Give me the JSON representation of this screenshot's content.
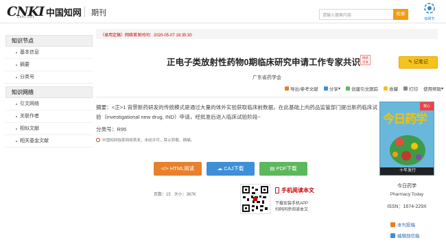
{
  "header": {
    "logo_mark": "CNKI",
    "logo_cn": "中国知网",
    "logo_sub": "cnki.net",
    "section": "期刊",
    "search_placeholder": "请输入搜索内容",
    "search_button": "检索",
    "brand_sub": "知网节"
  },
  "sidebar": {
    "groups": [
      {
        "title": "知识节点",
        "items": [
          "基本信息",
          "摘要",
          "分类号"
        ]
      },
      {
        "title": "知识网络",
        "items": [
          "引文网络",
          "关联作者",
          "相似文献",
          "相关基金文献"
        ]
      }
    ]
  },
  "article": {
    "pub_notice": "（录用定稿）网络首发时间：2020-05-07 16:35:30",
    "title": "正电子类放射性药物0期临床研究申请工作专家共识",
    "tag": "网络首发",
    "note_button": "记笔记",
    "author": "广东省药学会",
    "toolbar": [
      "导出/参考文献",
      "分享",
      "创建引文跟踪",
      "收藏",
      "打印",
      "使用帮助"
    ],
    "abstract_label": "摘要：",
    "abstract": "<正>1 背景新药研发的传统模式是通过大量的体外实验获取临床前数据，在此基础上向药品监管部门提出新药临床试验（investigational new drug, IND）申请，经批准后进入临床试验阶段~",
    "class_label": "分类号：",
    "class_value": "R95",
    "copyright": "中国知网独家网络首发，未经许可，禁止转载、摘编。"
  },
  "downloads": {
    "html": "HTML阅读",
    "caj": "CAJ下载",
    "pdf": "PDF下载"
  },
  "meta": {
    "pages_label": "页数：",
    "pages": "15",
    "size_label": "大小：",
    "size": "367K"
  },
  "mobile": {
    "title": "手机阅读本文",
    "line1": "下载安装手机APP",
    "line2": "扫码同步阅读本文"
  },
  "journal": {
    "cover_title": "今日药学",
    "cover_band": "核心",
    "cover_foot": "十年发行",
    "name": "今日药学",
    "name_en": "Pharmacy Today",
    "issn": "ISSN：1674-229X",
    "link1": "本刊投稿",
    "link2": "编辑部信箱"
  },
  "colors": {
    "accent": "#f39c12",
    "link": "#2a6dbd",
    "red": "#cc0000"
  }
}
